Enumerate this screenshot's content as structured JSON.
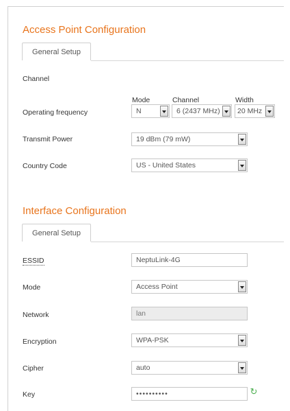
{
  "access_point": {
    "title": "Access Point Configuration",
    "tab": "General Setup",
    "channel_heading": "Channel",
    "columns": {
      "mode": "Mode",
      "channel": "Channel",
      "width": "Width"
    },
    "operating_frequency": {
      "label": "Operating frequency",
      "mode": "N",
      "channel": "6 (2437 MHz)",
      "width": "20 MHz"
    },
    "transmit_power": {
      "label": "Transmit Power",
      "value": "19 dBm (79 mW)"
    },
    "country_code": {
      "label": "Country Code",
      "value": "US - United States"
    }
  },
  "interface": {
    "title": "Interface Configuration",
    "tab": "General Setup",
    "essid": {
      "label": "ESSID",
      "value": "NeptuLink-4G"
    },
    "mode": {
      "label": "Mode",
      "value": "Access Point"
    },
    "network": {
      "label": "Network",
      "value": "lan"
    },
    "encryption": {
      "label": "Encryption",
      "value": "WPA-PSK"
    },
    "cipher": {
      "label": "Cipher",
      "value": "auto"
    },
    "key": {
      "label": "Key",
      "value": "••••••••••"
    }
  },
  "icons": {
    "key_refresh": "refresh-icon"
  },
  "colors": {
    "accent": "#e8741c",
    "refresh": "#4caf50"
  }
}
